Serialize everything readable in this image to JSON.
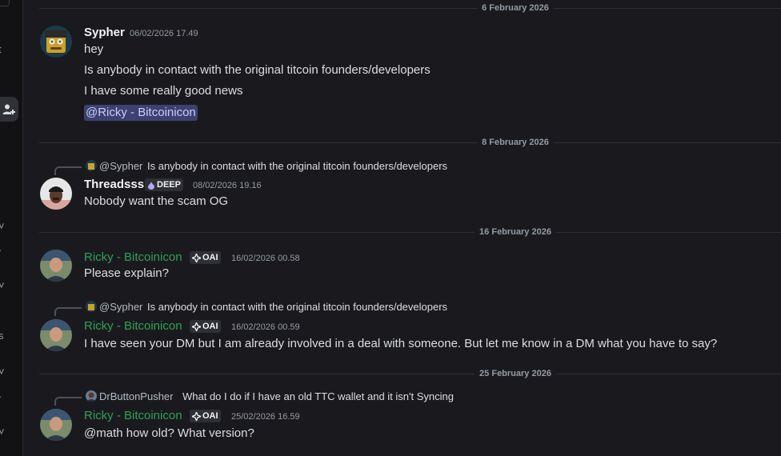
{
  "sidebar": {
    "glyphs": [
      "t",
      "˅",
      "·",
      "˅",
      "s",
      "˅",
      "·",
      "˅"
    ]
  },
  "dividers": [
    {
      "label": "6 February 2026"
    },
    {
      "label": "8 February 2026"
    },
    {
      "label": "16 February 2026"
    },
    {
      "label": "25 February 2026"
    }
  ],
  "messages": [
    {
      "author": "Sypher",
      "timestamp": "06/02/2026 17.49",
      "lines": [
        "hey",
        "Is anybody in contact with the original titcoin founders/developers",
        "I have some really good news"
      ],
      "mention": "@Ricky - Bitcoinicon"
    },
    {
      "reply": {
        "name": "@Sypher",
        "text": "Is anybody in contact with the original titcoin founders/developers"
      },
      "author": "Threadsss",
      "tag": "DEEP",
      "timestamp": "08/02/2026 19.16",
      "text": "Nobody want the scam OG"
    },
    {
      "author": "Ricky - Bitcoinicon",
      "tag": "OAI",
      "timestamp": "16/02/2026 00.58",
      "text": "Please explain?"
    },
    {
      "reply": {
        "name": "@Sypher",
        "text": "Is anybody in contact with the original titcoin founders/developers"
      },
      "author": "Ricky - Bitcoinicon",
      "tag": "OAI",
      "timestamp": "16/02/2026 00.59",
      "text": "I have seen your DM but I am already involved in a deal with someone. But let me know in a DM what you have to say?"
    },
    {
      "reply": {
        "name": "DrButtonPusher",
        "text": "What do I do if I have an old TTC wallet and it isn't Syncing"
      },
      "author": "Ricky - Bitcoinicon",
      "tag": "OAI",
      "timestamp": "25/02/2026 16.59",
      "text": "@math how old? What version?"
    }
  ],
  "colors": {
    "background": "#1a1a1e",
    "divider": "#2e2f34",
    "role_green": "#2ea058",
    "mention_bg": "#3c4270",
    "mention_text": "#c9cdfb"
  },
  "icons": [
    "add-friend-icon",
    "reply-spine",
    "user-avatar",
    "deep-tag-icon",
    "oai-tag-icon"
  ]
}
